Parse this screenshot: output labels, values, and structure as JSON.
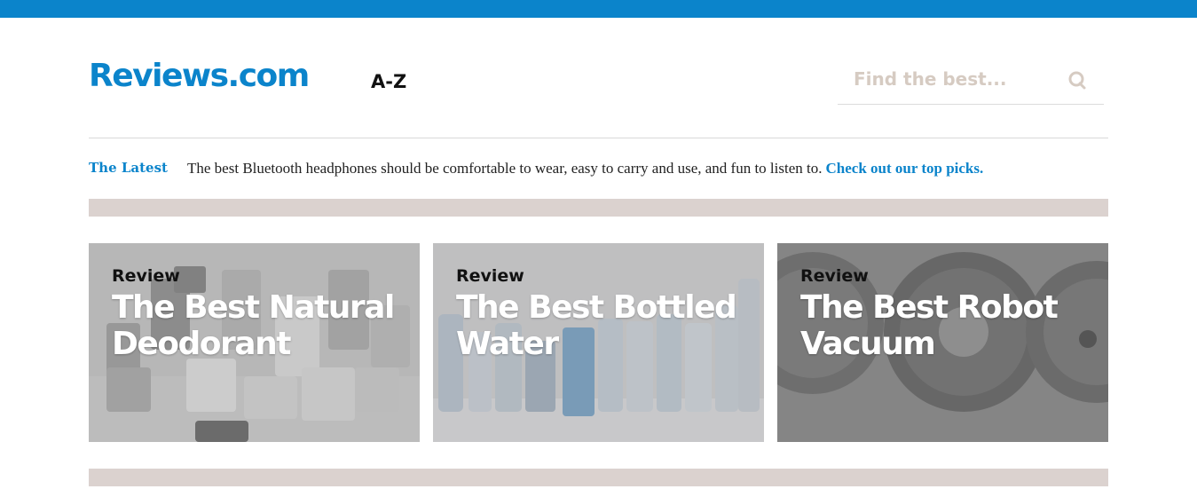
{
  "colors": {
    "brand": "#0b84cb",
    "band": "#dbd2cf",
    "placeholder": "#d6cbc2"
  },
  "header": {
    "logo": "Reviews.com",
    "az_label": "A-Z",
    "search": {
      "placeholder": "Find the best...",
      "icon": "search-icon"
    }
  },
  "latest": {
    "label": "The Latest",
    "text": "The best Bluetooth headphones should be comfortable to wear, easy to carry and use, and fun to listen to.",
    "link": "Check out our top picks."
  },
  "cards": [
    {
      "kicker": "Review",
      "title": "The Best Natural Deodorant",
      "image": "deodorant-jars-photo"
    },
    {
      "kicker": "Review",
      "title": "The Best Bottled Water",
      "image": "water-bottles-photo"
    },
    {
      "kicker": "Review",
      "title": "The Best Robot Vacuum",
      "image": "robot-vacuums-photo"
    }
  ]
}
